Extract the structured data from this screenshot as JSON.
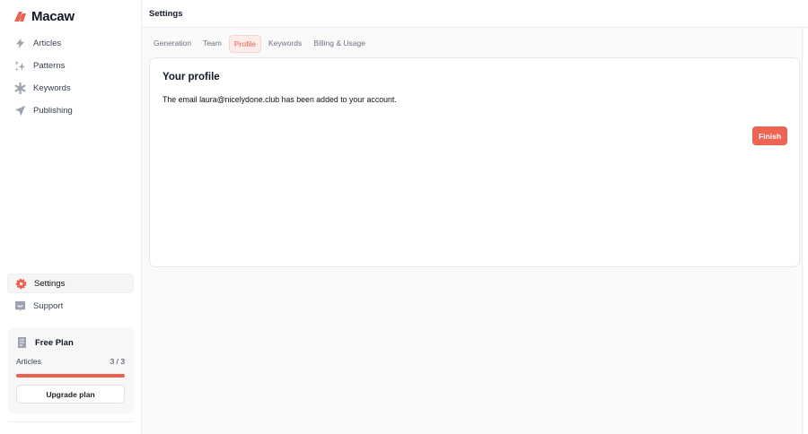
{
  "app": {
    "name": "Macaw",
    "brand_color": "#ef5f4f"
  },
  "sidebar": {
    "items": [
      {
        "label": "Articles",
        "icon": "bolt-icon"
      },
      {
        "label": "Patterns",
        "icon": "sparkles-icon"
      },
      {
        "label": "Keywords",
        "icon": "asterisk-icon"
      },
      {
        "label": "Publishing",
        "icon": "send-icon"
      }
    ],
    "bottom_items": [
      {
        "label": "Settings",
        "icon": "gear-icon",
        "active": true
      },
      {
        "label": "Support",
        "icon": "support-icon"
      }
    ]
  },
  "plan": {
    "title": "Free Plan",
    "label": "Articles",
    "count": "3 / 3",
    "progress": 1.0,
    "upgrade_label": "Upgrade plan"
  },
  "header": {
    "title": "Settings"
  },
  "tabs": [
    {
      "label": "Generation"
    },
    {
      "label": "Team"
    },
    {
      "label": "Profile",
      "active": true
    },
    {
      "label": "Keywords"
    },
    {
      "label": "Billing & Usage"
    }
  ],
  "card": {
    "title": "Your profile",
    "message": "The email laura@nicelydone.club has been added to your account.",
    "finish_label": "Finish"
  }
}
